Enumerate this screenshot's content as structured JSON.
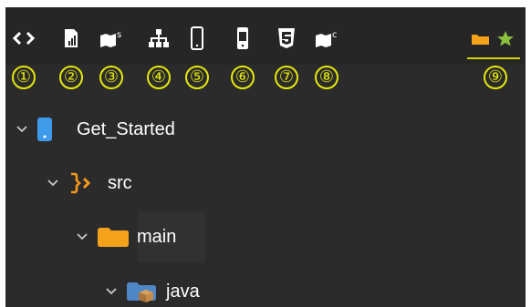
{
  "toolbar": {
    "tools": [
      {
        "icon": "code-brackets-icon",
        "number": "①"
      },
      {
        "icon": "document-chart-icon",
        "number": "②"
      },
      {
        "icon": "map-s-icon",
        "number": "③"
      },
      {
        "icon": "hierarchy-icon",
        "number": "④"
      },
      {
        "icon": "phone-outline-icon",
        "number": "⑤"
      },
      {
        "icon": "phone-screen-icon",
        "number": "⑥"
      },
      {
        "icon": "html5-icon",
        "number": "⑦"
      },
      {
        "icon": "map-c-icon",
        "number": "⑧"
      }
    ],
    "active_tab": {
      "icons": [
        "folder-icon",
        "star-icon"
      ],
      "number": "⑨"
    }
  },
  "tree": {
    "nodes": [
      {
        "label": "Get_Started",
        "icon": "mobile-app-icon",
        "expanded": true
      },
      {
        "label": "src",
        "icon": "source-bracket-icon",
        "expanded": true
      },
      {
        "label": "main",
        "icon": "folder-icon",
        "expanded": true
      },
      {
        "label": "java",
        "icon": "java-package-icon",
        "expanded": true
      }
    ]
  },
  "colors": {
    "accent": "#e4e80a",
    "folder": "#f6a11a",
    "star": "#8bbf3c",
    "device": "#3e9be9"
  }
}
